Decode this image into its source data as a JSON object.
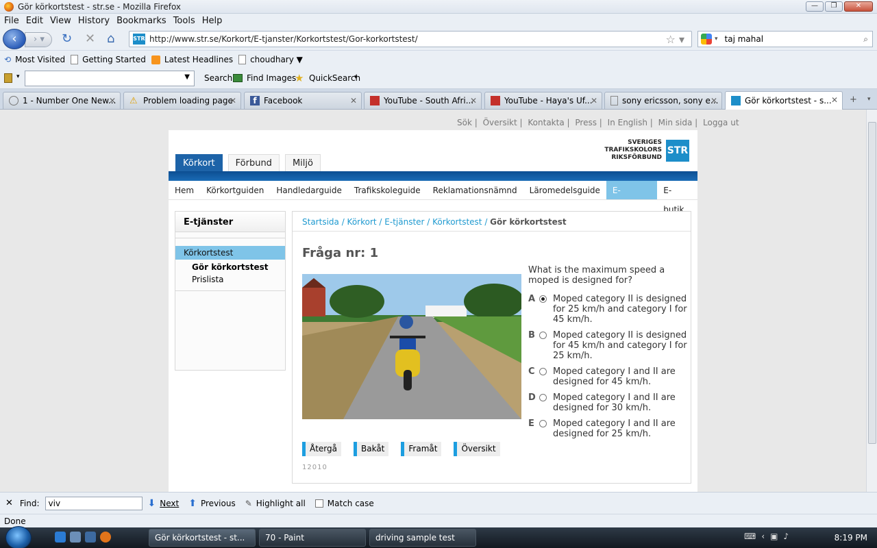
{
  "window": {
    "title": "Gör körkortstest - str.se - Mozilla Firefox"
  },
  "menu": [
    "File",
    "Edit",
    "View",
    "History",
    "Bookmarks",
    "Tools",
    "Help"
  ],
  "nav": {
    "url": "http://www.str.se/Korkort/E-tjanster/Korkortstest/Gor-korkortstest/",
    "search_value": "taj mahal"
  },
  "bookmarks": [
    "Most Visited",
    "Getting Started",
    "Latest Headlines",
    "choudhary ▼"
  ],
  "addon": {
    "search_label": "Search",
    "find_images": "Find Images",
    "quicksearch": "QuickSearch"
  },
  "tabs": [
    {
      "label": "1 - Number One New..."
    },
    {
      "label": "Problem loading page"
    },
    {
      "label": "Facebook"
    },
    {
      "label": "YouTube - South Afri..."
    },
    {
      "label": "YouTube - Haya's Uf..."
    },
    {
      "label": "sony ericsson, sony e..."
    },
    {
      "label": "Gör körkortstest - s..."
    }
  ],
  "page": {
    "toplinks": [
      "Sök |",
      "Översikt |",
      "Kontakta |",
      "Press |",
      "In English |",
      "Min sida |",
      "Logga ut"
    ],
    "sitetabs": [
      "Körkort",
      "Förbund",
      "Miljö"
    ],
    "logo_text": [
      "SVERIGES",
      "TRAFIKSKOLORS",
      "RIKSFÖRBUND"
    ],
    "logo_box": "STR",
    "submenu": [
      "Hem",
      "Körkortguiden",
      "Handledarguide",
      "Trafikskoleguide",
      "Reklamationsnämnd",
      "Läromedelsguide",
      "E-tjänster",
      "E-butik"
    ],
    "left": {
      "heading": "E-tjänster",
      "item": "Körkortstest",
      "sub1": "Gör körkortstest",
      "sub2": "Prislista"
    },
    "breadcrumb": {
      "links": [
        "Startsida",
        "Körkort",
        "E-tjänster",
        "Körkortstest"
      ],
      "current": "Gör körkortstest"
    },
    "question_title": "Fråga nr: 1",
    "question": "What is the maximum speed a moped is designed for?",
    "options": [
      {
        "letter": "A",
        "text": "Moped category II is designed for 25 km/h and category I for 45 km/h.",
        "selected": true
      },
      {
        "letter": "B",
        "text": "Moped category II is designed for 45 km/h and category I for 25 km/h.",
        "selected": false
      },
      {
        "letter": "C",
        "text": "Moped category I and II are designed for 45 km/h.",
        "selected": false
      },
      {
        "letter": "D",
        "text": "Moped category I and II are designed for 30 km/h.",
        "selected": false
      },
      {
        "letter": "E",
        "text": "Moped category I and II are designed for 25 km/h.",
        "selected": false
      }
    ],
    "buttons": [
      "Återgå",
      "Bakåt",
      "Framåt",
      "Översikt"
    ],
    "code": "12010"
  },
  "find": {
    "label": "Find:",
    "value": "viv",
    "next": "Next",
    "previous": "Previous",
    "highlight": "Highlight all",
    "match": "Match case"
  },
  "status": "Done",
  "taskbar": {
    "tasks": [
      "Gör körkortstest - st...",
      "70 - Paint",
      "driving sample test"
    ],
    "clock": "8:19 PM"
  },
  "colors": {
    "accent": "#1d63a8",
    "link": "#1f9ad0",
    "highlight": "#7fc4e8"
  }
}
